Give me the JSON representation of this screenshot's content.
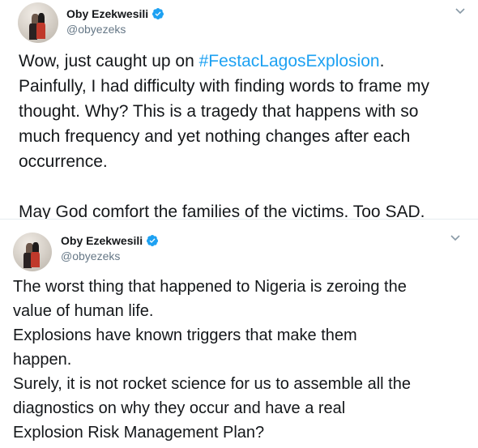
{
  "tweets": [
    {
      "author": {
        "name": "Oby Ezekwesili",
        "handle": "@obyezeks"
      },
      "lines": [
        {
          "before": "Wow, just caught up on ",
          "hashtag": "#FestacLagosExplosion",
          "after": "."
        },
        {
          "text": "Painfully, I had difficulty with finding words to frame my"
        },
        {
          "text": "thought. Why? This is a tragedy that happens with so"
        },
        {
          "text": "much frequency and yet nothing changes after each"
        },
        {
          "text": "occurrence."
        },
        {
          "text": ""
        },
        {
          "text": "May God comfort the families of the victims. Too SAD."
        }
      ]
    },
    {
      "author": {
        "name": "Oby Ezekwesili",
        "handle": "@obyezeks"
      },
      "lines": [
        {
          "text": "The worst thing that happened to Nigeria is zeroing the"
        },
        {
          "text": "value of human life."
        },
        {
          "text": "Explosions have known triggers that make them"
        },
        {
          "text": "happen."
        },
        {
          "text": "Surely, it is not rocket science for us to assemble all the"
        },
        {
          "text": "diagnostics on why they occur and have a real"
        },
        {
          "text": "Explosion Risk Management Plan?"
        }
      ]
    }
  ],
  "colors": {
    "hashtag": "#1da1f2",
    "verified": "#1da1f2",
    "handle": "#657786",
    "text": "#14171a"
  },
  "icons": {
    "verified": "verified-badge-icon",
    "menu": "chevron-down-icon"
  }
}
